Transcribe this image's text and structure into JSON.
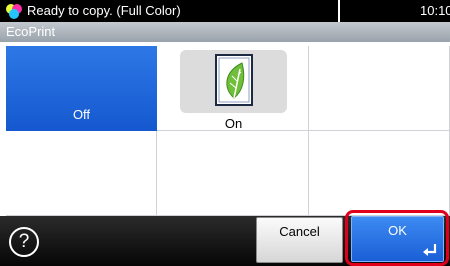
{
  "status": {
    "message": "Ready to copy. (Full Color)",
    "time": "10:10",
    "icon": "full-color-icon"
  },
  "title": "EcoPrint",
  "options": [
    {
      "label": "Off",
      "selected": true
    },
    {
      "label": "On",
      "selected": false,
      "icon": "leaf-icon"
    }
  ],
  "footer": {
    "help_label": "?",
    "cancel_label": "Cancel",
    "ok_label": "OK",
    "ok_icon": "enter-icon"
  },
  "colors": {
    "selected": "#1e63dc",
    "highlight": "#e0001b",
    "leaf": "#6fbf3a"
  }
}
